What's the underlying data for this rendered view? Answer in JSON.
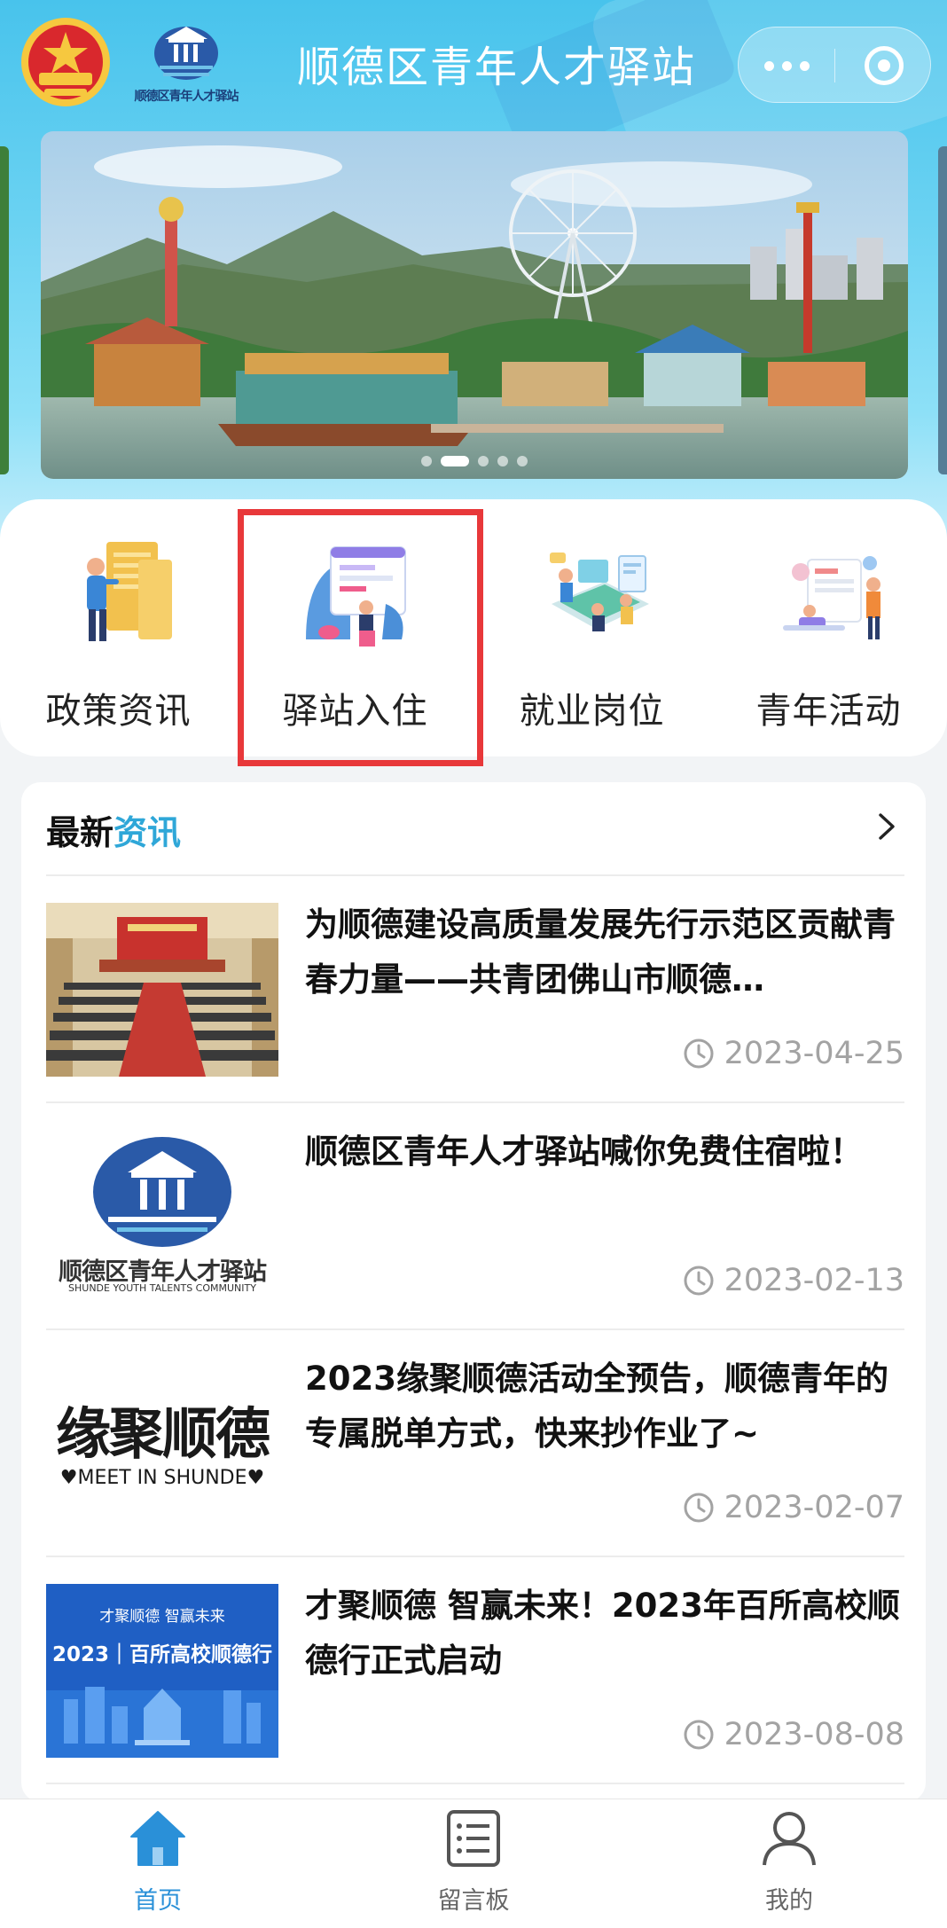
{
  "header": {
    "title": "顺德区青年人才驿站",
    "league_logo_icon": "communist-youth-league-emblem",
    "station_logo_text": "顺德区青年人才驿站",
    "more_icon": "more-dots-icon",
    "close_icon": "miniprogram-close-icon"
  },
  "banner": {
    "image": "amusement-park-with-ferris-wheel",
    "slide_count": 5,
    "active_slide": 1
  },
  "quick_nav": {
    "items": [
      {
        "label": "政策资讯",
        "icon": "policy-document-illustration"
      },
      {
        "label": "驿站入住",
        "icon": "station-checkin-illustration"
      },
      {
        "label": "就业岗位",
        "icon": "job-positions-illustration"
      },
      {
        "label": "青年活动",
        "icon": "youth-activities-illustration"
      }
    ],
    "highlight_color": "#e8383a"
  },
  "news": {
    "heading_main": "最新",
    "heading_accent": "资讯",
    "accent_color": "#2fa7d8",
    "items": [
      {
        "title": "为顺德建设高质量发展先行示范区贡献青春力量——共青团佛山市顺德…",
        "date": "2023-04-25",
        "thumb": "conference-hall-photo"
      },
      {
        "title": "顺德区青年人才驿站喊你免费住宿啦！",
        "date": "2023-02-13",
        "thumb": "station-logo-image",
        "thumb_text": "顺德区青年人才驿站",
        "thumb_subtext": "SHUNDE YOUTH TALENTS COMMUNITY"
      },
      {
        "title": "2023缘聚顺德活动全预告，顺德青年的专属脱单方式，快来抄作业了~",
        "date": "2023-02-07",
        "thumb": "meet-in-shunde-logo",
        "thumb_text": "缘聚顺德",
        "thumb_subtext": "♥MEET IN SHUNDE♥"
      },
      {
        "title": "才聚顺德 智赢未来！2023年百所高校顺德行正式启动",
        "date": "2023-08-08",
        "thumb": "campus-tour-poster",
        "thumb_text": "2023｜百所高校顺德行",
        "thumb_subtext": "才聚顺德  智赢未来"
      }
    ]
  },
  "tab_bar": {
    "tabs": [
      {
        "label": "首页",
        "icon": "home-icon",
        "active": true
      },
      {
        "label": "留言板",
        "icon": "message-board-icon",
        "active": false
      },
      {
        "label": "我的",
        "icon": "profile-icon",
        "active": false
      }
    ],
    "active_color": "#2a90d8"
  }
}
